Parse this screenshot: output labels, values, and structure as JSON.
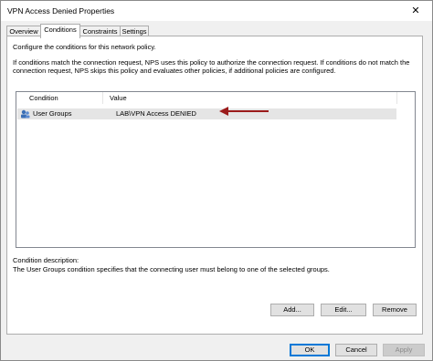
{
  "window": {
    "title": "VPN Access Denied Properties",
    "close_glyph": "✕"
  },
  "tabs": [
    {
      "label": "Overview",
      "active": false
    },
    {
      "label": "Conditions",
      "active": true
    },
    {
      "label": "Constraints",
      "active": false
    },
    {
      "label": "Settings",
      "active": false
    }
  ],
  "panel": {
    "intro": "Configure the conditions for this network policy.",
    "explanation": "If conditions match the connection request, NPS uses this policy to authorize the connection request. If conditions do not match the connection request, NPS skips this policy and evaluates other policies, if additional policies are configured.",
    "table": {
      "headers": [
        "Condition",
        "Value"
      ],
      "rows": [
        {
          "condition": "User Groups",
          "value": "LAB\\VPN Access DENIED",
          "icon": "user-group-icon"
        }
      ]
    },
    "condition_description_label": "Condition description:",
    "condition_description": "The User Groups condition specifies that the connecting user must belong to one of the selected groups.",
    "buttons": {
      "add": "Add...",
      "edit": "Edit...",
      "remove": "Remove"
    }
  },
  "footer": {
    "ok": "OK",
    "cancel": "Cancel",
    "apply": "Apply"
  },
  "colors": {
    "annotation_arrow": "#9b1b1b",
    "selected_row": "#e5e5e5",
    "accent": "#0078d7"
  }
}
